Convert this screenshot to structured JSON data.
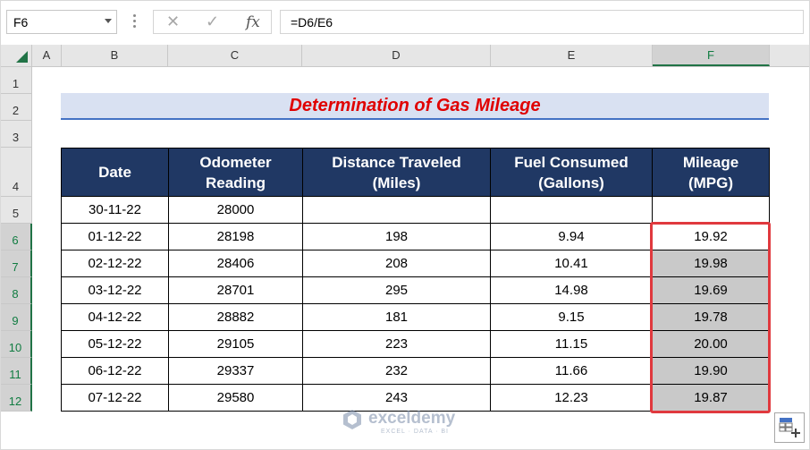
{
  "name_box": {
    "value": "F6"
  },
  "formula_bar": {
    "cancel_glyph": "✕",
    "enter_glyph": "✓",
    "fx_label": "fx",
    "formula": "=D6/E6"
  },
  "columns": [
    "A",
    "B",
    "C",
    "D",
    "E",
    "F"
  ],
  "selected_column": "F",
  "rows": [
    "1",
    "2",
    "3",
    "4",
    "5",
    "6",
    "7",
    "8",
    "9",
    "10",
    "11",
    "12"
  ],
  "selected_rows": [
    "6",
    "7",
    "8",
    "9",
    "10",
    "11",
    "12"
  ],
  "title": "Determination of Gas Mileage",
  "table": {
    "headers": [
      {
        "line1": "Date",
        "line2": ""
      },
      {
        "line1": "Odometer",
        "line2": "Reading"
      },
      {
        "line1": "Distance Traveled",
        "line2": "(Miles)"
      },
      {
        "line1": "Fuel Consumed",
        "line2": "(Gallons)"
      },
      {
        "line1": "Mileage",
        "line2": "(MPG)"
      }
    ],
    "rows": [
      [
        "30-11-22",
        "28000",
        "",
        "",
        ""
      ],
      [
        "01-12-22",
        "28198",
        "198",
        "9.94",
        "19.92"
      ],
      [
        "02-12-22",
        "28406",
        "208",
        "10.41",
        "19.98"
      ],
      [
        "03-12-22",
        "28701",
        "295",
        "14.98",
        "19.69"
      ],
      [
        "04-12-22",
        "28882",
        "181",
        "9.15",
        "19.78"
      ],
      [
        "05-12-22",
        "29105",
        "223",
        "11.15",
        "20.00"
      ],
      [
        "06-12-22",
        "29337",
        "232",
        "11.66",
        "19.90"
      ],
      [
        "07-12-22",
        "29580",
        "243",
        "12.23",
        "19.87"
      ]
    ]
  },
  "watermark": {
    "name": "exceldemy",
    "tagline": "EXCEL · DATA · BI"
  },
  "colors": {
    "header_bg": "#203864",
    "title_color": "#e00000",
    "selection_border": "#e0393e",
    "excel_green": "#217346"
  }
}
